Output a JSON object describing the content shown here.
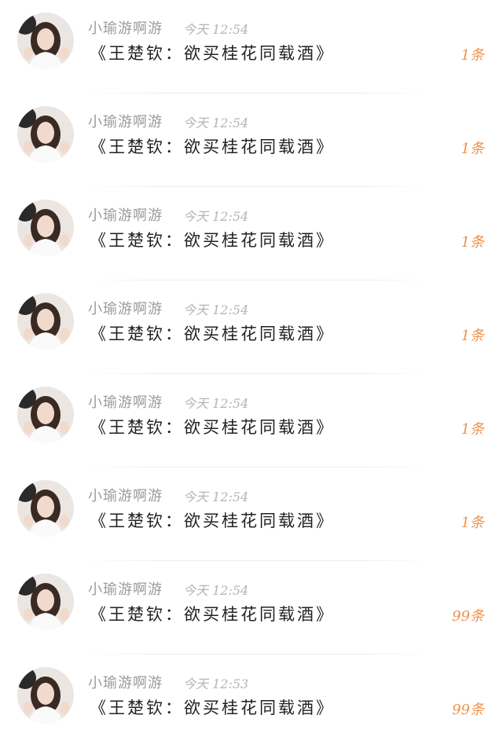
{
  "colors": {
    "username": "#9a9a9a",
    "time": "#b4b4b4",
    "title": "#222222",
    "count": "#f0924a",
    "divider": "#eeeeee"
  },
  "messages": [
    {
      "username": "小瑜游啊游",
      "time": "今天 12:54",
      "title": "《王楚钦：欲买桂花同载酒》",
      "count": "1条"
    },
    {
      "username": "小瑜游啊游",
      "time": "今天 12:54",
      "title": "《王楚钦：欲买桂花同载酒》",
      "count": "1条"
    },
    {
      "username": "小瑜游啊游",
      "time": "今天 12:54",
      "title": "《王楚钦：欲买桂花同载酒》",
      "count": "1条"
    },
    {
      "username": "小瑜游啊游",
      "time": "今天 12:54",
      "title": "《王楚钦：欲买桂花同载酒》",
      "count": "1条"
    },
    {
      "username": "小瑜游啊游",
      "time": "今天 12:54",
      "title": "《王楚钦：欲买桂花同载酒》",
      "count": "1条"
    },
    {
      "username": "小瑜游啊游",
      "time": "今天 12:54",
      "title": "《王楚钦：欲买桂花同载酒》",
      "count": "1条"
    },
    {
      "username": "小瑜游啊游",
      "time": "今天 12:54",
      "title": "《王楚钦：欲买桂花同载酒》",
      "count": "99条"
    },
    {
      "username": "小瑜游啊游",
      "time": "今天 12:53",
      "title": "《王楚钦：欲买桂花同载酒》",
      "count": "99条"
    }
  ]
}
